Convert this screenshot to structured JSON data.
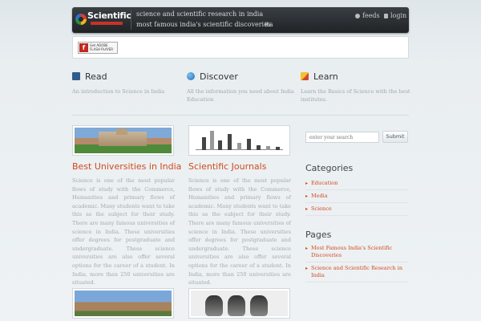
{
  "header": {
    "logo_text": "Scientific",
    "nav": [
      {
        "label": "science and scientific research in india"
      },
      {
        "label": "most famous india's scientific discoveries"
      },
      {
        "label": "ita"
      }
    ],
    "feeds_label": "feeds",
    "login_label": "login"
  },
  "banner": {
    "flash_badge_text": "Get ADOBE FLASH PLAYER"
  },
  "features": [
    {
      "title": "Read",
      "icon": "book-icon",
      "description": "An introduction to Science in India"
    },
    {
      "title": "Discover",
      "icon": "globe-icon",
      "description": "All the information you need about India Education"
    },
    {
      "title": "Learn",
      "icon": "pencil-icon",
      "description": "Learn the Basics of Science with the best institutes."
    }
  ],
  "posts": [
    {
      "title": "Best Universities in India",
      "image": "university-campus",
      "body": "Science is one of the most popular flows of study with the Commerce, Humanities and primary flows of academic. Many students want to take this as the subject for their study. There are many famous universities of science in India. These universities offer degrees for postgraduate and undergraduate. These science universities are also offer several options for the career of a student. In India, more than 250 universities are situated."
    },
    {
      "title": "Scientific Journals",
      "image": "bar-chart",
      "body": "Science is one of the most popular flows of study with the Commerce, Humanities and primary flows of academic. Many students want to take this as the subject for their study. There are many famous universities of science in India. These universities offer degrees for postgraduate and undergraduate. These science universities are also offer several options for the career of a student. In India, more than 250 universities are situated."
    }
  ],
  "sidebar": {
    "search_placeholder": "enter your search",
    "search_button": "Submit",
    "categories_heading": "Categories",
    "categories": [
      "Education",
      "Media",
      "Science"
    ],
    "pages_heading": "Pages",
    "pages": [
      "Most Famous India's Scientific Discoveries",
      "Science and Scientific Research in India"
    ]
  },
  "colors": {
    "accent": "#d24a1e",
    "topbar": "#2a2e32"
  }
}
